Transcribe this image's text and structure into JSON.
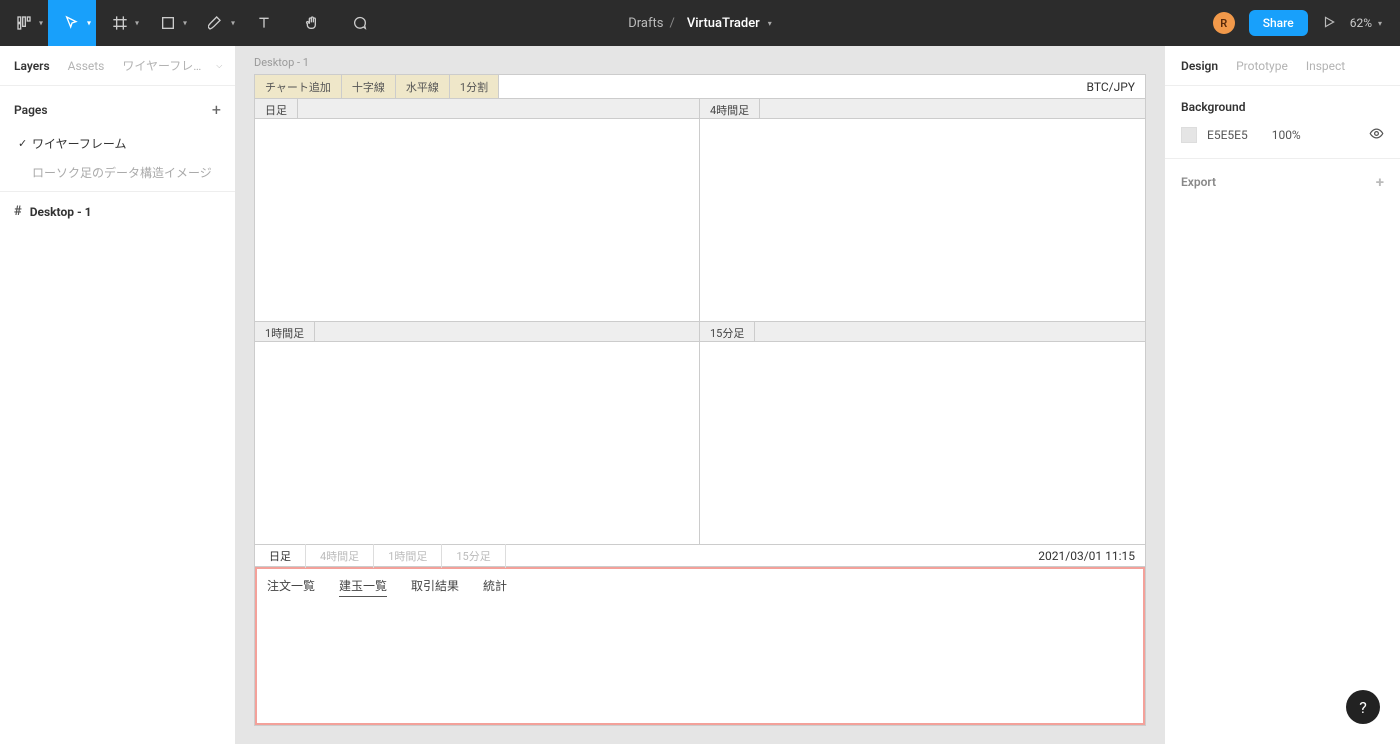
{
  "topbar": {
    "location_folder": "Drafts",
    "location_project": "VirtuaTrader",
    "avatar_letter": "R",
    "share_label": "Share",
    "zoom": "62%"
  },
  "left_panel": {
    "tab_layers": "Layers",
    "tab_assets": "Assets",
    "dropdown_label": "ワイヤーフレー…",
    "pages_header": "Pages",
    "pages": [
      {
        "label": "ワイヤーフレーム",
        "checked": true
      },
      {
        "label": "ローソク足のデータ構造イメージ",
        "checked": false
      }
    ],
    "frame_label": "Desktop - 1"
  },
  "right_panel": {
    "tab_design": "Design",
    "tab_prototype": "Prototype",
    "tab_inspect": "Inspect",
    "bg_header": "Background",
    "bg_hex": "E5E5E5",
    "bg_opacity": "100%",
    "export_header": "Export"
  },
  "canvas": {
    "frame_label": "Desktop - 1",
    "toolbar_buttons": [
      "チャート追加",
      "十字線",
      "水平線",
      "1分割"
    ],
    "currency_pair": "BTC/JPY",
    "cells": [
      "日足",
      "4時間足",
      "1時間足",
      "15分足"
    ],
    "timeframes": [
      {
        "label": "日足",
        "active": true
      },
      {
        "label": "4時間足",
        "active": false
      },
      {
        "label": "1時間足",
        "active": false
      },
      {
        "label": "15分足",
        "active": false
      }
    ],
    "datetime": "2021/03/01 11:15",
    "bottom_tabs": [
      {
        "label": "注文一覧",
        "active": false
      },
      {
        "label": "建玉一覧",
        "active": true
      },
      {
        "label": "取引結果",
        "active": false
      },
      {
        "label": "統計",
        "active": false
      }
    ]
  },
  "help_label": "?"
}
